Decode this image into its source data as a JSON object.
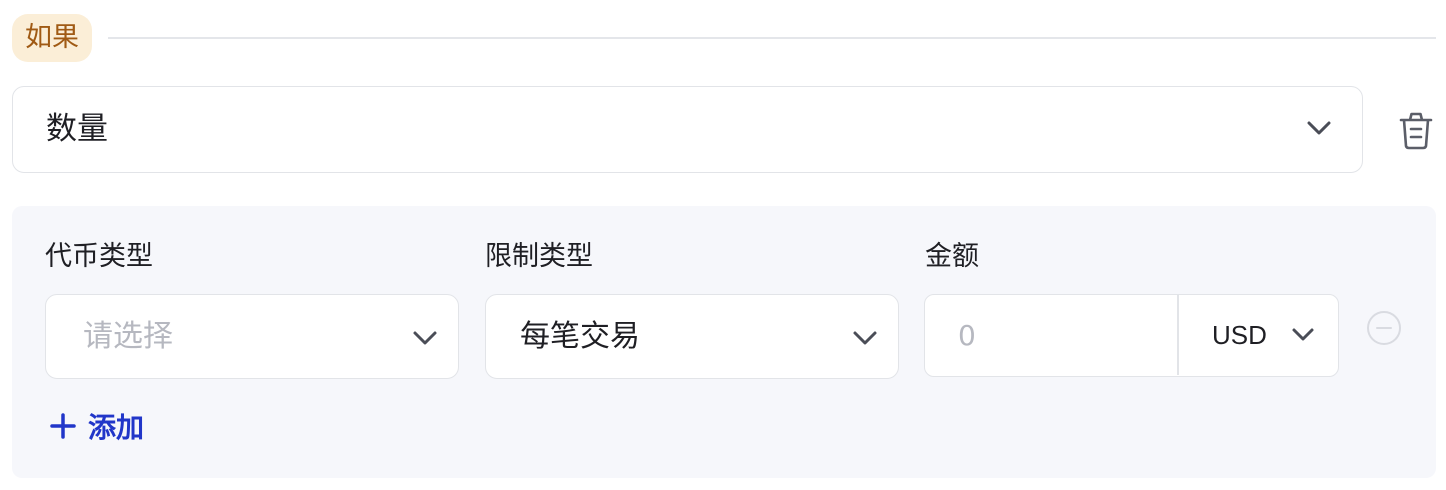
{
  "condition": {
    "badge_label": "如果"
  },
  "metric_select": {
    "value": "数量",
    "icon": "chevron-down-icon"
  },
  "delete": {
    "icon": "trash-icon"
  },
  "rule_panel": {
    "token_type": {
      "label": "代币类型",
      "placeholder": "请选择"
    },
    "limit_type": {
      "label": "限制类型",
      "value": "每笔交易"
    },
    "amount": {
      "label": "金额",
      "placeholder": "0",
      "currency": "USD"
    },
    "remove_icon": "minus-circle-icon",
    "add_button": {
      "label": "添加",
      "icon": "plus-icon"
    }
  },
  "colors": {
    "badge_bg": "#fbeed7",
    "badge_text": "#a05a14",
    "accent": "#2136c9",
    "panel_bg": "#f6f7fb",
    "border": "#e2e4e8"
  }
}
